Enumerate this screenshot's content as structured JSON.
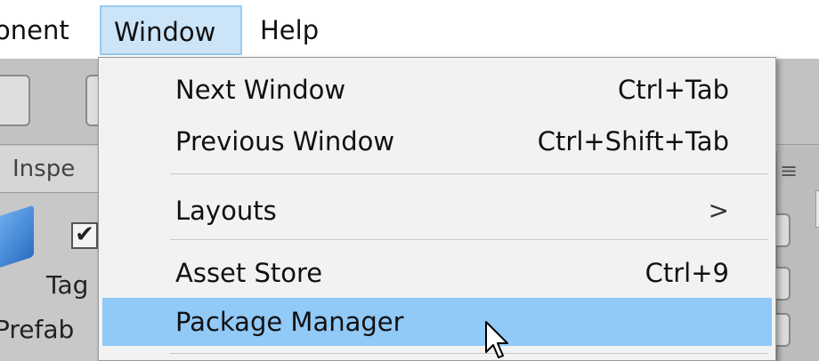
{
  "menubar": {
    "component_label": "onent",
    "window_label": "Window",
    "help_label": "Help"
  },
  "inspector": {
    "tab_label": "Inspe",
    "checkbox_mark": "✔",
    "tag_label": "Tag",
    "prefab_label": "Prefab",
    "panel_glyph": "≡"
  },
  "window_menu": {
    "items": [
      {
        "label": "Next Window",
        "shortcut": "Ctrl+Tab"
      },
      {
        "label": "Previous Window",
        "shortcut": "Ctrl+Shift+Tab"
      },
      {
        "label": "Layouts",
        "submenu_indicator": ">"
      },
      {
        "label": "Asset Store",
        "shortcut": "Ctrl+9"
      },
      {
        "label": "Package Manager",
        "highlighted": true
      }
    ]
  },
  "colors": {
    "highlight": "#91c9f7",
    "menubar_active": "#cce4f7",
    "menu_background": "#f2f2f2"
  },
  "icons": [
    "cube-icon",
    "pointer-cursor-icon",
    "chevron-right-icon"
  ]
}
